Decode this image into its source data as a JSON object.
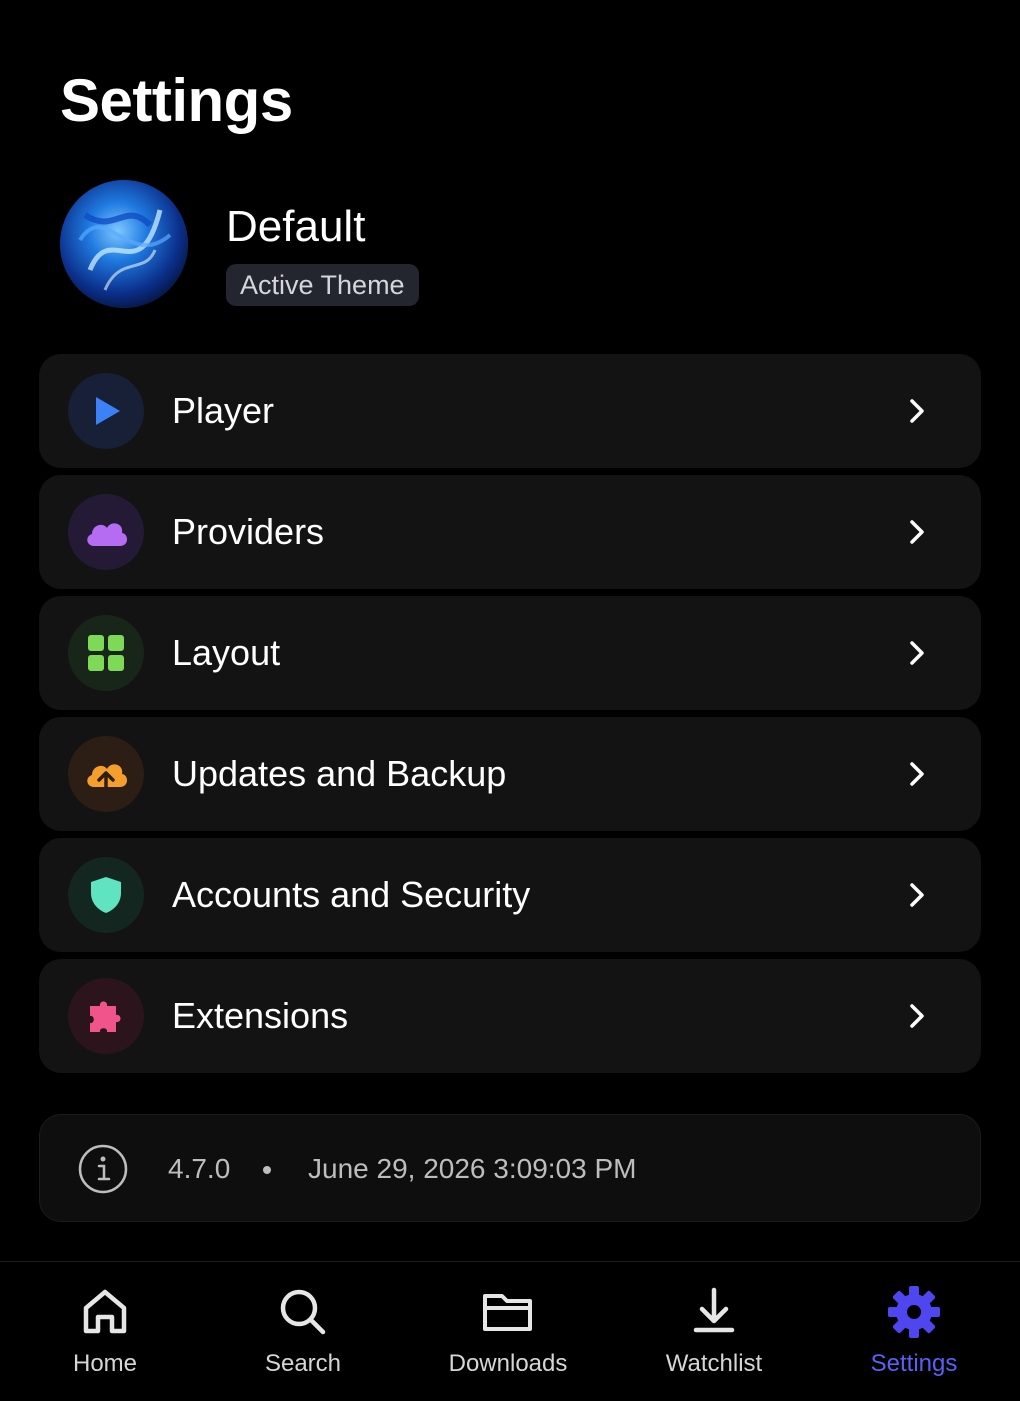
{
  "header": {
    "title": "Settings"
  },
  "theme": {
    "name": "Default",
    "badge": "Active Theme"
  },
  "menu": {
    "items": [
      {
        "label": "Player",
        "icon": "play-icon",
        "accent": "#3b82f6",
        "icon_bg": "#172036"
      },
      {
        "label": "Providers",
        "icon": "cloud-icon",
        "accent": "#b66cf2",
        "icon_bg": "#241a36"
      },
      {
        "label": "Layout",
        "icon": "grid-icon",
        "accent": "#7ed957",
        "icon_bg": "#18261a"
      },
      {
        "label": "Updates and Backup",
        "icon": "cloud-upload-icon",
        "accent": "#f59e2e",
        "icon_bg": "#2c1e14"
      },
      {
        "label": "Accounts and Security",
        "icon": "shield-icon",
        "accent": "#5fe3c0",
        "icon_bg": "#142620"
      },
      {
        "label": "Extensions",
        "icon": "puzzle-icon",
        "accent": "#f0548a",
        "icon_bg": "#2c141c"
      }
    ]
  },
  "info": {
    "version": "4.7.0",
    "separator": "•",
    "date": "June 29, 2026 3:09:03 PM"
  },
  "nav": {
    "items": [
      {
        "label": "Home",
        "icon": "home-icon",
        "active": false
      },
      {
        "label": "Search",
        "icon": "search-icon",
        "active": false
      },
      {
        "label": "Downloads",
        "icon": "folder-icon",
        "active": false
      },
      {
        "label": "Watchlist",
        "icon": "download-icon",
        "active": false
      },
      {
        "label": "Settings",
        "icon": "gear-icon",
        "active": true
      }
    ],
    "active_color": "#5b5ff5"
  }
}
